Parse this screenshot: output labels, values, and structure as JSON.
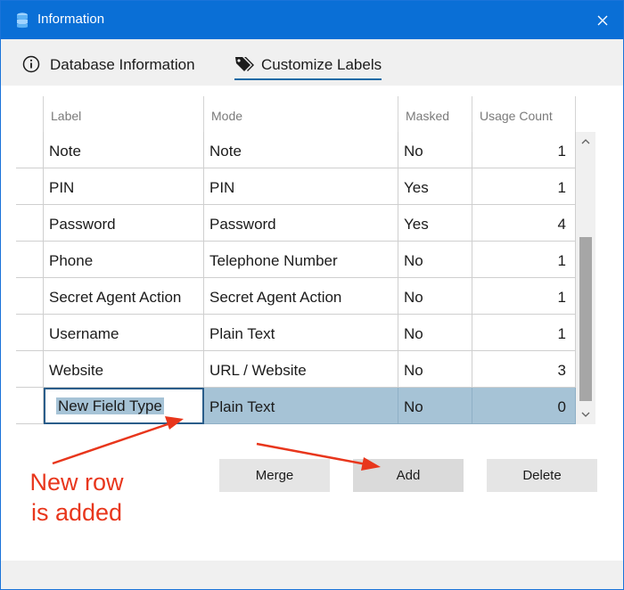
{
  "window": {
    "title": "Information",
    "app_icon": "database-icon",
    "close_icon": "close-icon"
  },
  "tabs": [
    {
      "label": "Database Information",
      "icon": "info-circle-icon",
      "active": false
    },
    {
      "label": "Customize Labels",
      "icon": "tags-icon",
      "active": true
    }
  ],
  "table": {
    "columns": [
      "Label",
      "Mode",
      "Masked",
      "Usage Count"
    ],
    "rows": [
      {
        "label": "Note",
        "mode": "Note",
        "masked": "No",
        "count": "1"
      },
      {
        "label": "PIN",
        "mode": "PIN",
        "masked": "Yes",
        "count": "1"
      },
      {
        "label": "Password",
        "mode": "Password",
        "masked": "Yes",
        "count": "4"
      },
      {
        "label": "Phone",
        "mode": "Telephone Number",
        "masked": "No",
        "count": "1"
      },
      {
        "label": "Secret Agent Action",
        "mode": "Secret Agent Action",
        "masked": "No",
        "count": "1"
      },
      {
        "label": "Username",
        "mode": "Plain Text",
        "masked": "No",
        "count": "1"
      },
      {
        "label": "Website",
        "mode": "URL / Website",
        "masked": "No",
        "count": "3"
      },
      {
        "label": "New Field Type",
        "mode": "Plain Text",
        "masked": "No",
        "count": "0",
        "selected": true,
        "editing": true
      }
    ]
  },
  "buttons": {
    "merge": "Merge",
    "add": "Add",
    "delete": "Delete"
  },
  "annotation": {
    "line1": "New row",
    "line2": "is added",
    "color": "#e8361c"
  },
  "colors": {
    "titlebar": "#0a6fd6",
    "selected_row": "#a6c3d6",
    "tab_underline": "#1b6aa5"
  }
}
